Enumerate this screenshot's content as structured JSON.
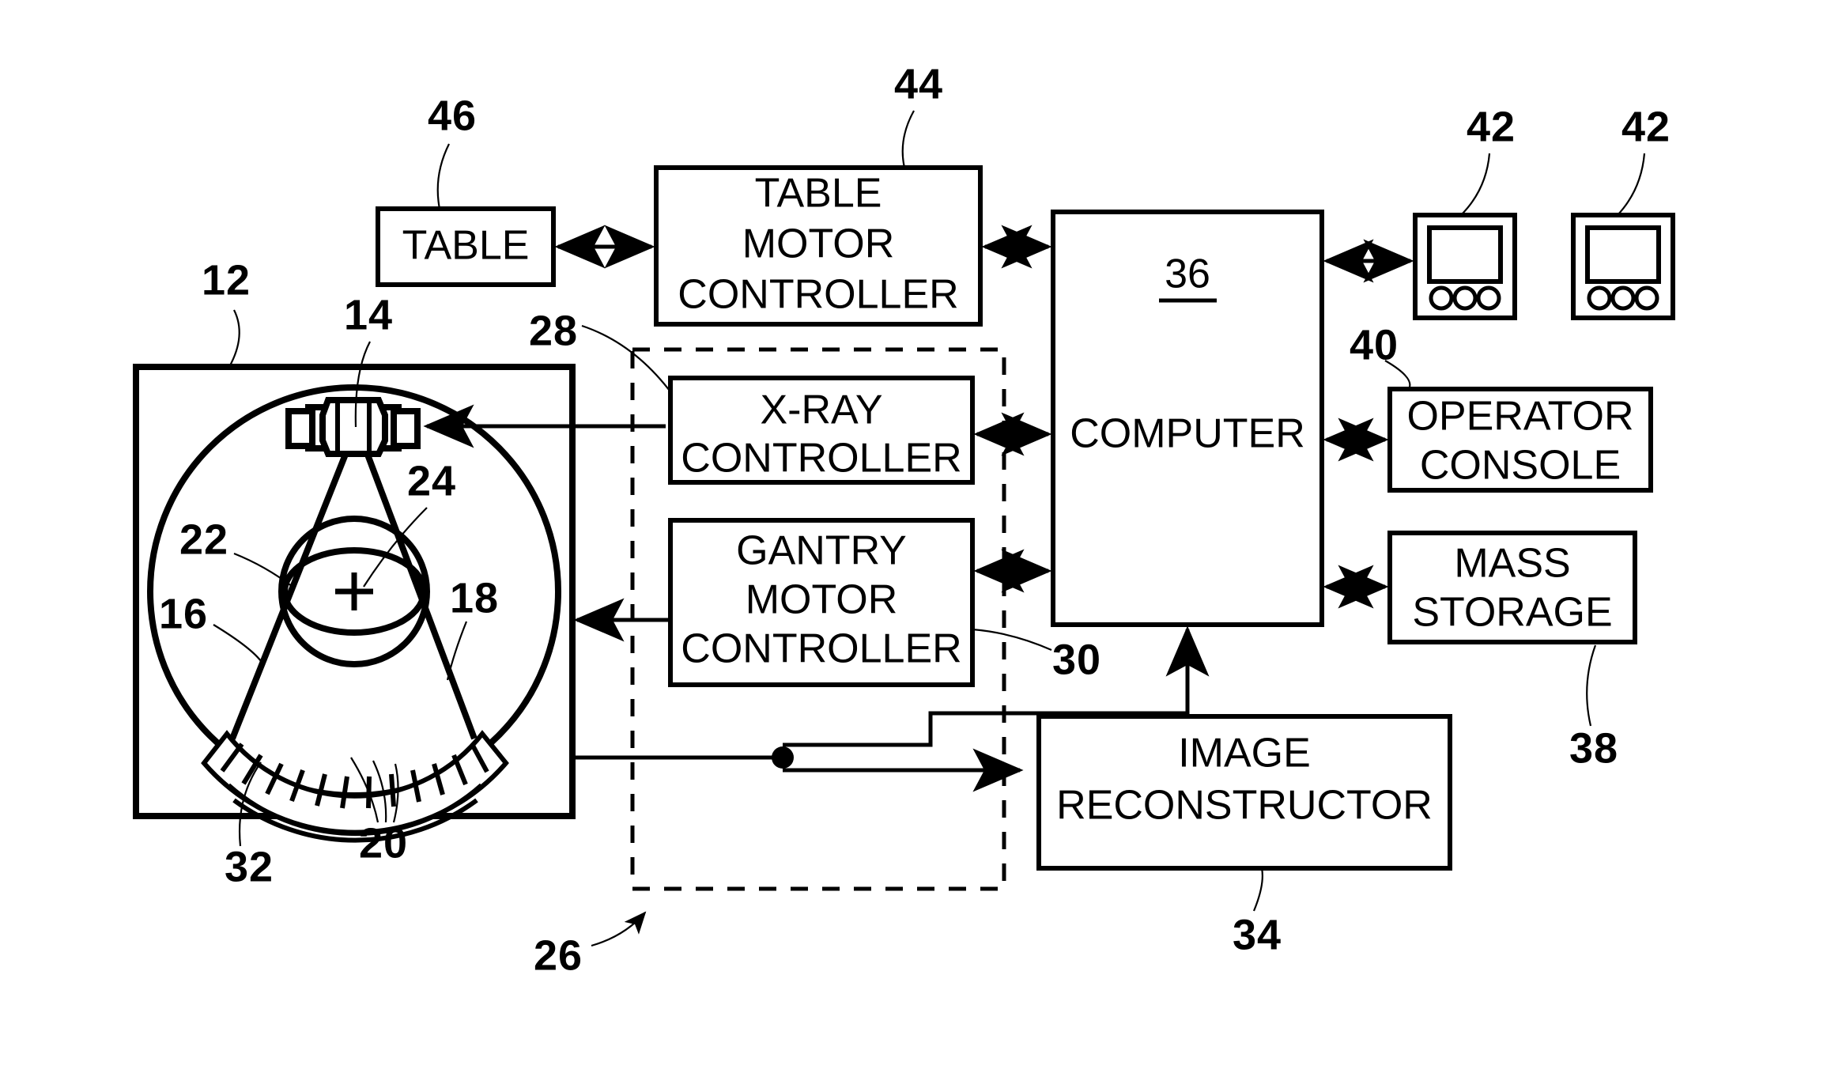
{
  "figure": {
    "title": "CT imaging system block diagram",
    "background": "#ffffff",
    "ink": "#000000"
  },
  "blocks": {
    "table": {
      "label": "TABLE",
      "ref": "46"
    },
    "table_motor_controller": {
      "line1": "TABLE",
      "line2": "MOTOR",
      "line3": "CONTROLLER",
      "ref": "44"
    },
    "xray_controller": {
      "line1": "X-RAY",
      "line2": "CONTROLLER",
      "ref": ""
    },
    "gantry_motor_controller": {
      "line1": "GANTRY",
      "line2": "MOTOR",
      "line3": "CONTROLLER",
      "ref": "30"
    },
    "computer": {
      "label": "COMPUTER",
      "inner_ref": "36"
    },
    "operator_console": {
      "line1": "OPERATOR",
      "line2": "CONSOLE",
      "ref": "40"
    },
    "mass_storage": {
      "line1": "MASS",
      "line2": "STORAGE",
      "ref": "38"
    },
    "image_reconstructor": {
      "line1": "IMAGE",
      "line2": "RECONSTRUCTOR",
      "ref": "34"
    },
    "display_left": {
      "ref": "42"
    },
    "display_right": {
      "ref": "42"
    },
    "control_mechanism": {
      "ref": "26"
    }
  },
  "gantry": {
    "ref_gantry_frame": "12",
    "ref_xray_source": "14",
    "ref_gantry_ring": "22",
    "ref_rotating_member": "16",
    "ref_fan_beam": "18",
    "ref_isocenter": "24",
    "ref_detector_array": "20",
    "ref_patient_bore": "32"
  },
  "ref_numbers": {
    "n12": "12",
    "n14": "14",
    "n16": "16",
    "n18": "18",
    "n20": "20",
    "n22": "22",
    "n24": "24",
    "n26": "26",
    "n28": "28",
    "n30": "30",
    "n32": "32",
    "n34": "34",
    "n36": "36",
    "n38": "38",
    "n40": "40",
    "n42a": "42",
    "n42b": "42",
    "n44": "44",
    "n46": "46"
  }
}
